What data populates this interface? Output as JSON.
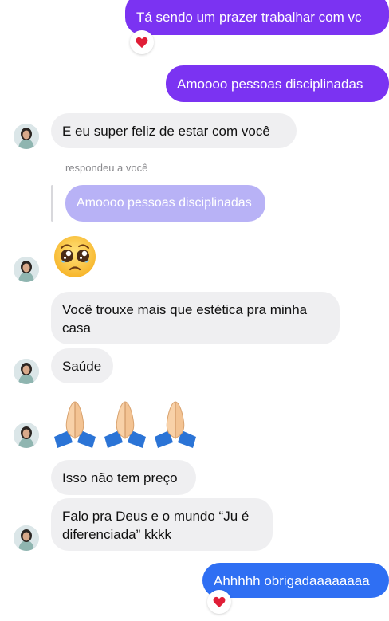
{
  "colors": {
    "sent_purple": "#7b33f2",
    "sent_blue": "#2f6ff3",
    "received_bg": "#efeff1",
    "quoted_bg": "#b8b2f6",
    "heart": "#e01e37"
  },
  "messages": [
    {
      "id": "m1",
      "direction": "sent",
      "text": "Tá sendo um prazer trabalhar com vc",
      "reaction": "heart-icon"
    },
    {
      "id": "m2",
      "direction": "sent",
      "text": "Amoooo pessoas disciplinadas"
    },
    {
      "id": "m3",
      "direction": "received",
      "text": "E eu super feliz de estar com você"
    },
    {
      "id": "m4",
      "direction": "received",
      "reply_label": "respondeu a você",
      "quoted_text": "Amoooo pessoas disciplinadas",
      "emoji": "pleading-face-icon"
    },
    {
      "id": "m5",
      "direction": "received",
      "text": "Você trouxe mais que estética pra minha casa"
    },
    {
      "id": "m6",
      "direction": "received",
      "text": "Saúde"
    },
    {
      "id": "m7",
      "direction": "received",
      "emoji": "folded-hands-icon",
      "emoji_count": 3
    },
    {
      "id": "m8",
      "direction": "received",
      "text": "Isso não tem preço"
    },
    {
      "id": "m9",
      "direction": "received",
      "text": "Falo pra Deus e o mundo “Ju é diferenciada” kkkk"
    },
    {
      "id": "m10",
      "direction": "sent",
      "text": "Ahhhhh obrigadaaaaaaaa",
      "reaction": "heart-icon"
    }
  ]
}
